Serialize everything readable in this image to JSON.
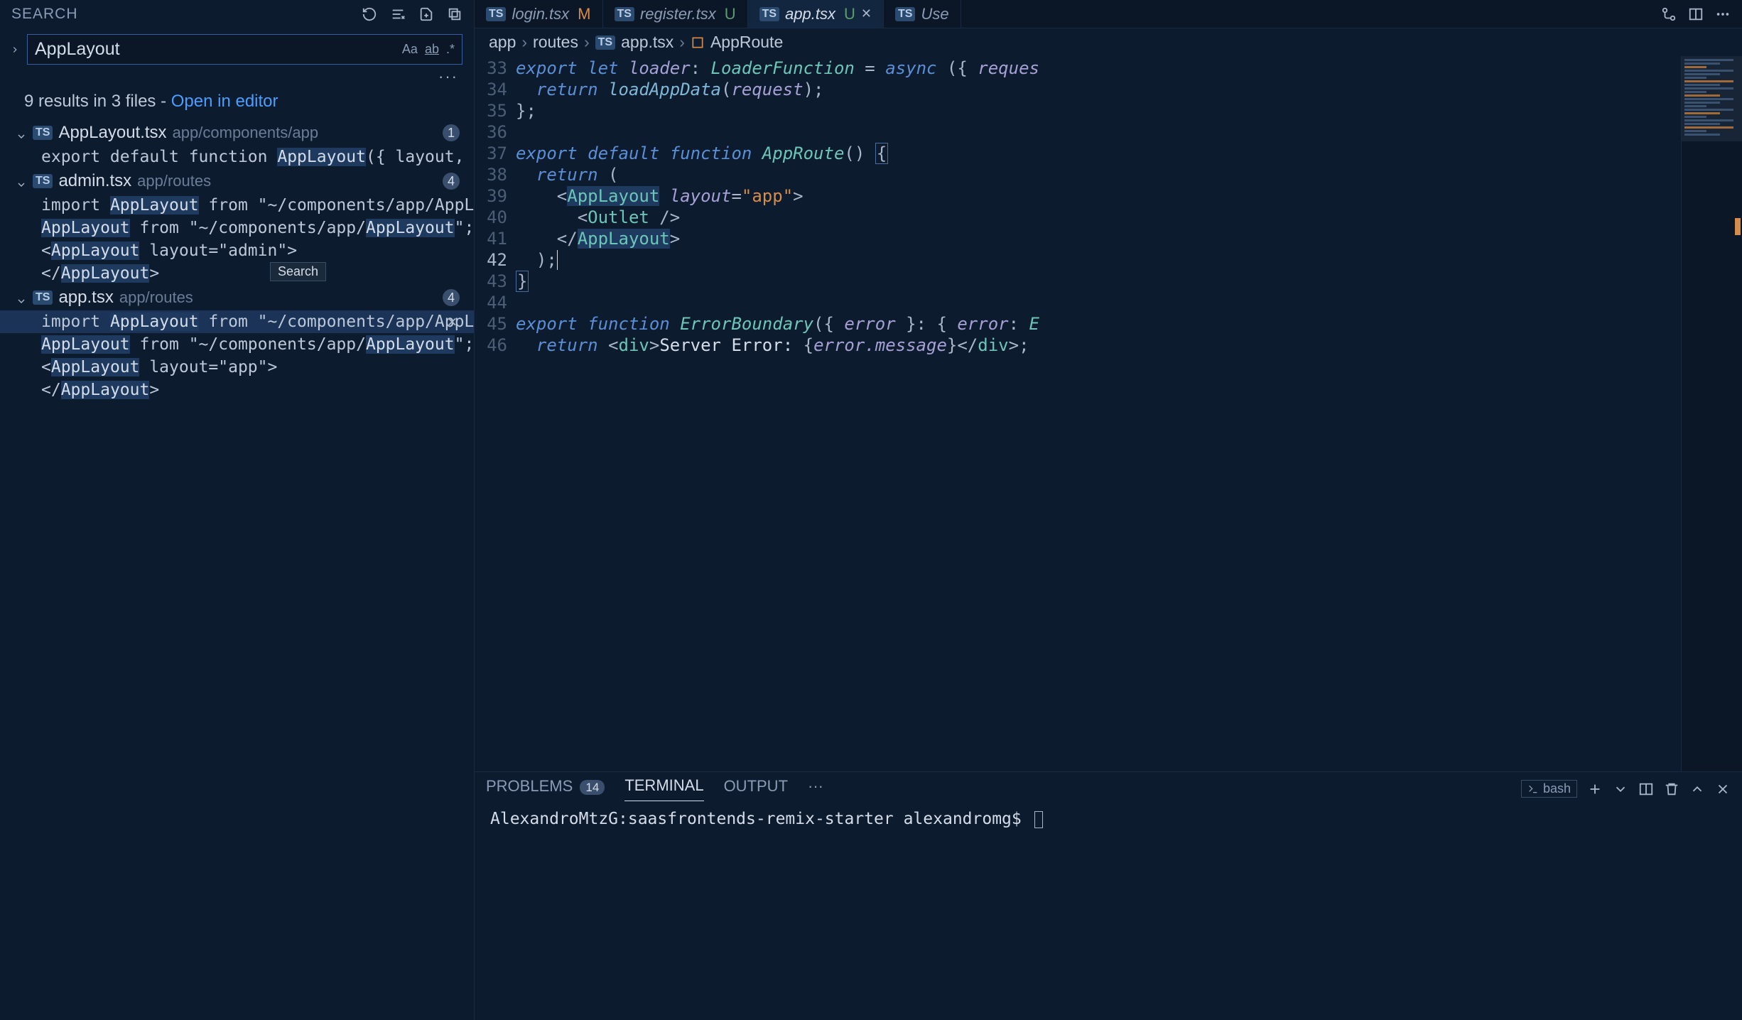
{
  "sidebar": {
    "title": "SEARCH",
    "searchValue": "AppLayout",
    "optCase": "Aa",
    "optWord": "ab",
    "optRegex": ".*",
    "summaryPrefix": "9 results in 3 files - ",
    "summaryLink": "Open in editor",
    "tooltip": "Search"
  },
  "tsBadge": "TS",
  "files": [
    {
      "name": "AppLayout.tsx",
      "path": "app/components/app",
      "count": "1",
      "matches": [
        {
          "pre": "export default function ",
          "hl": "AppLayout",
          "post": "({ layout, children }: Props) {"
        }
      ]
    },
    {
      "name": "admin.tsx",
      "path": "app/routes",
      "count": "4",
      "matches": [
        {
          "pre": "import ",
          "hl": "AppLayout",
          "post": " from \"~/components/app/AppLayout\";"
        },
        {
          "pre": "",
          "hl": "AppLayout",
          "post": " from \"~/components/app/",
          "hl2": "AppLayout",
          "post2": "\";"
        },
        {
          "pre": "<",
          "hl": "AppLayout",
          "post": " layout=\"admin\">"
        },
        {
          "pre": "</",
          "hl": "AppLayout",
          "post": ">"
        }
      ]
    },
    {
      "name": "app.tsx",
      "path": "app/routes",
      "count": "4",
      "matches": [
        {
          "pre": "import ",
          "hl": "AppLayout",
          "post": " from \"~/components/app/AppLayout\";",
          "selected": true
        },
        {
          "pre": "",
          "hl": "AppLayout",
          "post": " from \"~/components/app/",
          "hl2": "AppLayout",
          "post2": "\";"
        },
        {
          "pre": "<",
          "hl": "AppLayout",
          "post": " layout=\"app\">"
        },
        {
          "pre": "</",
          "hl": "AppLayout",
          "post": ">"
        }
      ]
    }
  ],
  "tabs": [
    {
      "name": "login.tsx",
      "status": "M",
      "statusClass": ""
    },
    {
      "name": "register.tsx",
      "status": "U",
      "statusClass": "u"
    },
    {
      "name": "app.tsx",
      "status": "U",
      "statusClass": "u",
      "active": true,
      "closable": true
    },
    {
      "name": "Use",
      "status": "",
      "truncated": true
    }
  ],
  "breadcrumb": {
    "seg1": "app",
    "seg2": "routes",
    "seg3": "app.tsx",
    "seg4": "AppRoute"
  },
  "editor": {
    "startLine": 33,
    "lines": [
      "33",
      "34",
      "35",
      "36",
      "37",
      "38",
      "39",
      "40",
      "41",
      "42",
      "43",
      "44",
      "45",
      "46"
    ],
    "currentLine": "42"
  },
  "code": {
    "l33a": "export",
    "l33b": " let",
    "l33c": " loader",
    "l33d": ":",
    "l33e": " LoaderFunction",
    "l33f": " = ",
    "l33g": "async",
    "l33h": " ({ ",
    "l33i": "reques",
    "l34a": "  return",
    "l34b": " loadAppData",
    "l34c": "(",
    "l34d": "request",
    "l34e": ");",
    "l35": "};",
    "l37a": "export",
    "l37b": " default",
    "l37c": " function",
    "l37d": " AppRoute",
    "l37e": "() ",
    "l37f": "{",
    "l38a": "  return",
    "l38b": " (",
    "l39a": "    <",
    "l39b": "AppLayout",
    "l39c": " layout",
    "l39d": "=",
    "l39e": "\"app\"",
    "l39f": ">",
    "l40a": "      <",
    "l40b": "Outlet",
    "l40c": " />",
    "l41a": "    </",
    "l41b": "AppLayout",
    "l41c": ">",
    "l42": "  );",
    "l43": "}",
    "l45a": "export",
    "l45b": " function",
    "l45c": " ErrorBoundary",
    "l45d": "({ ",
    "l45e": "error",
    "l45f": " }: { ",
    "l45g": "error",
    "l45h": ": ",
    "l45i": "E",
    "l46a": "  return",
    "l46b": " <",
    "l46c": "div",
    "l46d": ">",
    "l46e": "Server Error: ",
    "l46f": "{",
    "l46g": "error.message",
    "l46h": "}",
    "l46i": "</",
    "l46j": "div",
    "l46k": ">;"
  },
  "panel": {
    "problems": "PROBLEMS",
    "problemsCount": "14",
    "terminal": "TERMINAL",
    "output": "OUTPUT",
    "shell": "bash",
    "prompt": "AlexandroMtzG:saasfrontends-remix-starter alexandromg$"
  }
}
